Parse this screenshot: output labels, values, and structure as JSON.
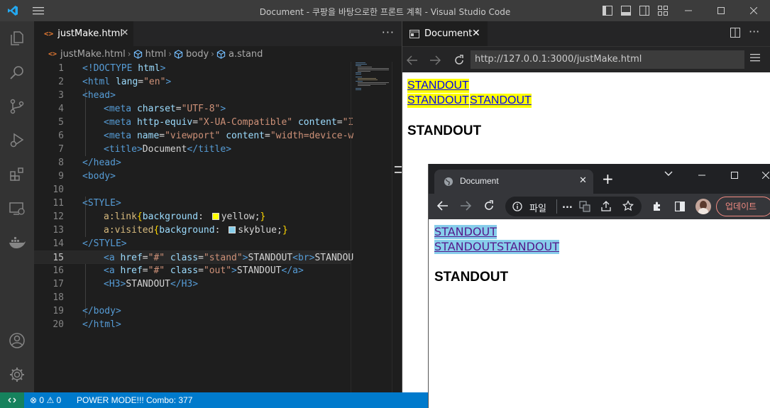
{
  "window": {
    "title": "Document - 쿠팡을 바탕으로한 프론트 계획 - Visual Studio Code"
  },
  "editor": {
    "tab_label": "justMake.html",
    "tab_icon": "html-file-icon",
    "breadcrumb": [
      "justMake.html",
      "html",
      "body",
      "a.stand"
    ],
    "line_numbers": [
      "1",
      "2",
      "3",
      "4",
      "5",
      "6",
      "7",
      "8",
      "9",
      "10",
      "11",
      "12",
      "13",
      "14",
      "15",
      "16",
      "17",
      "18",
      "19",
      "20"
    ],
    "code": {
      "l1": [
        "<!DOCTYPE",
        " html",
        ">"
      ],
      "l2": [
        "<html",
        " lang",
        "=",
        "\"en\"",
        ">"
      ],
      "l3": [
        "<head>"
      ],
      "l4": [
        "<meta",
        " charset",
        "=",
        "\"UTF-8\"",
        ">"
      ],
      "l5": [
        "<meta",
        " http-equiv",
        "=",
        "\"X-UA-Compatible\"",
        " content",
        "=",
        "\"I"
      ],
      "l6": [
        "<meta",
        " name",
        "=",
        "\"viewport\"",
        " content",
        "=",
        "\"width=device-w"
      ],
      "l7": [
        "<title>",
        "Document",
        "</title>"
      ],
      "l8": [
        "</head>"
      ],
      "l9": [
        "<body>"
      ],
      "l11": [
        "<STYLE>"
      ],
      "l12": [
        "a:link",
        "{",
        "background",
        ": ",
        "yellow",
        ";",
        "}"
      ],
      "l13": [
        "a:visited",
        "{",
        "background",
        ": ",
        "skyblue",
        ";",
        "}"
      ],
      "l14": [
        "</STYLE>"
      ],
      "l15": [
        "<a",
        " href",
        "=",
        "\"#\"",
        " class",
        "=",
        "\"stand\"",
        ">",
        "STANDOUT",
        "<br>",
        "STANDOU"
      ],
      "l16": [
        "<a",
        " href",
        "=",
        "\"#\"",
        " class",
        "=",
        "\"out\"",
        ">",
        "STANDOUT",
        "</a>"
      ],
      "l17": [
        "<H3>",
        "STANDOUT",
        "</H3>"
      ],
      "l19": [
        "</body>"
      ],
      "l20": [
        "</html>"
      ]
    },
    "swatch_colors": {
      "yellow": "#ffff00",
      "skyblue": "#87ceeb"
    }
  },
  "preview": {
    "tab_label": "Document",
    "url": "http://127.0.0.1:3000/justMake.html",
    "links": [
      "STANDOUT",
      "STANDOUT",
      "STANDOUT"
    ],
    "heading": "STANDOUT"
  },
  "chrome": {
    "tab_label": "Document",
    "omnibox_text": "파일",
    "omnibox_more": "...",
    "update_label": "업데이트",
    "links": [
      "STANDOUT",
      "STANDOUT",
      "STANDOUT"
    ],
    "heading": "STANDOUT"
  },
  "statusbar": {
    "errors": "0",
    "warnings": "0",
    "power_mode": "POWER MODE!!! Combo: 377"
  },
  "colors": {
    "accent": "#007acc",
    "remote": "#16825d"
  }
}
